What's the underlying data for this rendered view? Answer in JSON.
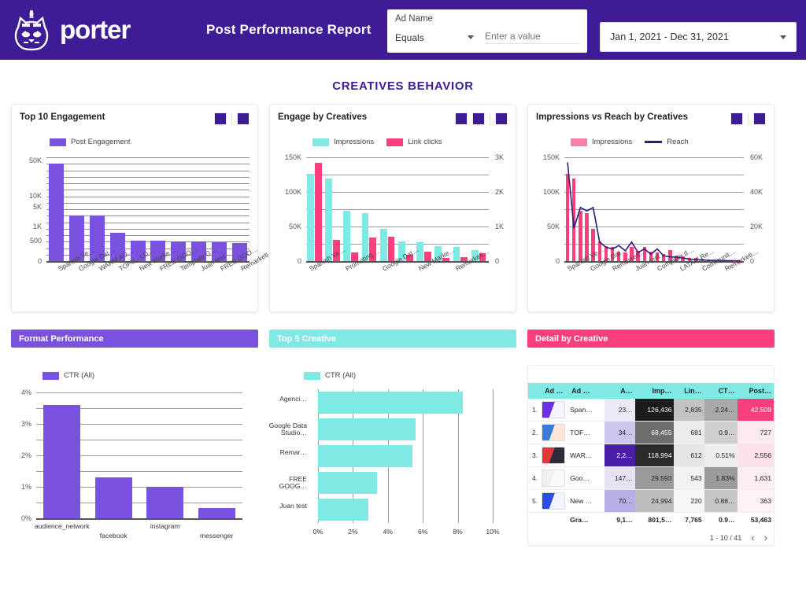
{
  "header": {
    "brand": "porter",
    "logo_icon": "unicorn-cat-logo",
    "report_title": "Post Performance Report",
    "filter": {
      "label": "Ad Name",
      "operator": "Equals",
      "value_placeholder": "Enter a value",
      "value": ""
    },
    "date_range": "Jan 1, 2021 - Dec 31, 2021"
  },
  "section_title": "CREATIVES BEHAVIOR",
  "colors": {
    "brand_purple": "#3d1c96",
    "bar_purple": "#7B52E0",
    "cyan": "#7FE9E4",
    "pink": "#FA3E7E",
    "reach_line": "#2B1C7A"
  },
  "cards": {
    "top10": {
      "title": "Top 10 Engagement"
    },
    "engage": {
      "title": "Engage by Creatives"
    },
    "impressions": {
      "title": "Impressions vs Reach by Creatives"
    }
  },
  "panels": {
    "format": {
      "title": "Format Performance"
    },
    "top5": {
      "title": "Top 5 Creative"
    },
    "detail": {
      "title": "Detail by Creative"
    }
  },
  "table": {
    "columns": [
      "",
      "Ad …",
      "Ad …",
      "A…",
      "Imp…",
      "Lin…",
      "CT…",
      "Post…"
    ],
    "rows": [
      {
        "index": "1.",
        "thumb": "ad-thumbnail-1",
        "ad_name": "Span…",
        "amount": "23…",
        "impressions": "126,436",
        "link_clicks": "2,835",
        "ctr": "2.24…",
        "post_engagement": "42,509"
      },
      {
        "index": "2.",
        "thumb": "ad-thumbnail-2",
        "ad_name": "TOF…",
        "amount": "34…",
        "impressions": "68,455",
        "link_clicks": "681",
        "ctr": "0.9…",
        "post_engagement": "727"
      },
      {
        "index": "3.",
        "thumb": "ad-thumbnail-3",
        "ad_name": "WAR…",
        "amount": "2,2…",
        "impressions": "118,994",
        "link_clicks": "612",
        "ctr": "0.51%",
        "post_engagement": "2,556"
      },
      {
        "index": "4.",
        "thumb": "ad-thumbnail-4",
        "ad_name": "Goo…",
        "amount": "147…",
        "impressions": "29,593",
        "link_clicks": "543",
        "ctr": "1.83%",
        "post_engagement": "1,631"
      },
      {
        "index": "5.",
        "thumb": "ad-thumbnail-5",
        "ad_name": "New …",
        "amount": "70…",
        "impressions": "24,994",
        "link_clicks": "220",
        "ctr": "0.88…",
        "post_engagement": "363"
      }
    ],
    "total_row": {
      "index": "",
      "ad_name": "Gra…",
      "amount": "9,1…",
      "impressions": "801,5…",
      "link_clicks": "7,765",
      "ctr": "0.9…",
      "post_engagement": "53,463"
    },
    "pagination": "1 - 10 / 41",
    "prev_icon": "chevron-left-icon",
    "next_icon": "chevron-right-icon"
  },
  "chart_data": [
    {
      "type": "bar",
      "title": "Top 10 Engagement",
      "legend": [
        "Post Engagement"
      ],
      "categories": [
        "Spanish Ve…",
        "Google Dat…",
        "WARM AU…",
        "TOFU - LO…",
        "New Marke…",
        "FREE GOO…",
        "Template G…",
        "Juan test",
        "FREE GOO…",
        "Remarketi…"
      ],
      "values": [
        42509,
        2556,
        2500,
        727,
        430,
        425,
        363,
        320,
        285,
        250
      ],
      "ylabel": "",
      "xlabel": "",
      "yticks": [
        "0",
        "500",
        "1K",
        "5K",
        "10K",
        "50K"
      ],
      "scale": "log",
      "series_color": "#7B52E0",
      "grid": true
    },
    {
      "type": "bar",
      "title": "Engage by Creatives",
      "legend": [
        "Impressions",
        "Link clicks"
      ],
      "categories": [
        "Spanish Ve…",
        "",
        "Promoting…",
        "",
        "Google Dat…",
        "",
        "New Marke…",
        "",
        "Remarketi…",
        ""
      ],
      "series": [
        {
          "name": "Impressions",
          "color": "#7FE9E4",
          "values": [
            126436,
            118994,
            73000,
            69000,
            47000,
            28000,
            27000,
            22000,
            21000,
            16000
          ]
        },
        {
          "name": "Link clicks",
          "color": "#FA3E7E",
          "values": [
            2835,
            612,
            250,
            680,
            700,
            190,
            280,
            100,
            120,
            220
          ]
        }
      ],
      "yticks_left": [
        "0",
        "50K",
        "100K",
        "150K"
      ],
      "yticks_right": [
        "0",
        "1K",
        "2K",
        "3K"
      ],
      "ylim_left": [
        0,
        150000
      ],
      "ylim_right": [
        0,
        3000
      ],
      "grid": true
    },
    {
      "type": "bar+line",
      "title": "Impressions vs Reach by Creatives",
      "legend": [
        "Impressions",
        "Reach"
      ],
      "categories": [
        "Spanish Ve…",
        "Google Dat…",
        "Remarketi…",
        "Juan test",
        "Complete d…",
        "LATAM Re…",
        "Communit…",
        "Remarketi…"
      ],
      "series": [
        {
          "name": "Impressions",
          "color": "#FA3E7E",
          "type": "bar",
          "values": [
            126436,
            118994,
            73000,
            69000,
            47000,
            28000,
            22000,
            20000,
            14000,
            13000,
            20000,
            15000,
            20000,
            14000,
            12000,
            10000,
            16000,
            8000,
            7000,
            5000,
            4000,
            3000,
            2000,
            1500,
            1000,
            800,
            500,
            300
          ]
        },
        {
          "name": "Reach",
          "color": "#2B1C7A",
          "type": "line",
          "values": [
            57000,
            19000,
            31000,
            29000,
            31000,
            11000,
            8000,
            7000,
            9000,
            6000,
            11000,
            5000,
            7000,
            4000,
            7000,
            3000,
            2500,
            2200,
            1800,
            1200,
            900,
            700,
            500,
            400,
            300,
            250,
            200,
            150
          ]
        }
      ],
      "yticks_left": [
        "0",
        "50K",
        "100K",
        "150K"
      ],
      "yticks_right": [
        "0",
        "20K",
        "40K",
        "60K"
      ],
      "ylim_left": [
        0,
        150000
      ],
      "ylim_right": [
        0,
        60000
      ],
      "grid": true
    },
    {
      "type": "bar",
      "title": "Format Performance",
      "legend": [
        "CTR (All)"
      ],
      "categories": [
        "audience_network",
        "facebook",
        "instagram",
        "messenger"
      ],
      "values": [
        3.6,
        1.3,
        1.0,
        0.33
      ],
      "yticks": [
        "0%",
        "1%",
        "2%",
        "3%",
        "4%"
      ],
      "ylim": [
        0,
        4
      ],
      "series_color": "#7B52E0",
      "grid": true
    },
    {
      "type": "bar",
      "title": "Top 5 Creative",
      "orientation": "horizontal",
      "legend": [
        "CTR (All)"
      ],
      "categories": [
        "Agenci…",
        "Google Data Studio…",
        "Remar…",
        "FREE GOOG…",
        "Juan test"
      ],
      "values": [
        8.3,
        5.6,
        5.4,
        3.4,
        2.9
      ],
      "xticks": [
        "0%",
        "2%",
        "4%",
        "6%",
        "8%",
        "10%"
      ],
      "xlim": [
        0,
        10
      ],
      "series_color": "#7FE9E4",
      "grid": true
    }
  ]
}
